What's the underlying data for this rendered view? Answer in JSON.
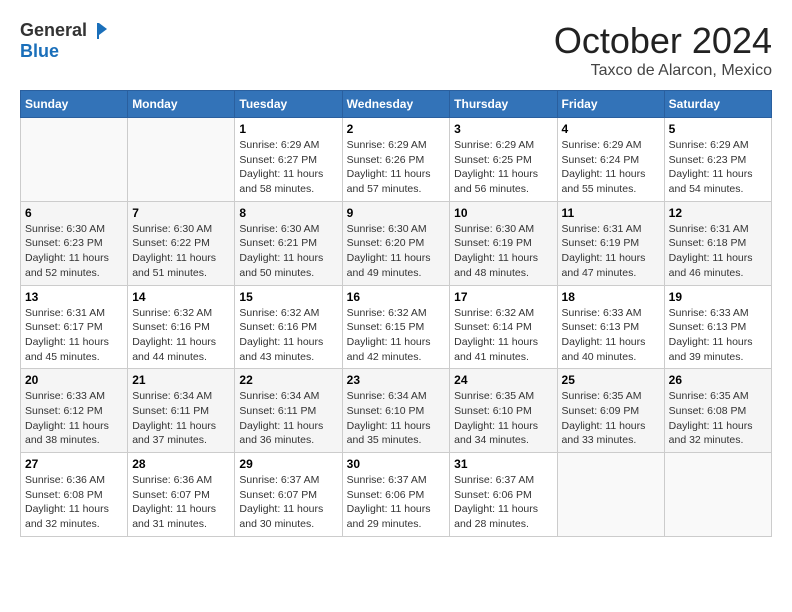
{
  "header": {
    "logo_line1": "General",
    "logo_line2": "Blue",
    "month": "October 2024",
    "location": "Taxco de Alarcon, Mexico"
  },
  "days_of_week": [
    "Sunday",
    "Monday",
    "Tuesday",
    "Wednesday",
    "Thursday",
    "Friday",
    "Saturday"
  ],
  "weeks": [
    [
      {
        "day": "",
        "content": ""
      },
      {
        "day": "",
        "content": ""
      },
      {
        "day": "1",
        "content": "Sunrise: 6:29 AM\nSunset: 6:27 PM\nDaylight: 11 hours\nand 58 minutes."
      },
      {
        "day": "2",
        "content": "Sunrise: 6:29 AM\nSunset: 6:26 PM\nDaylight: 11 hours\nand 57 minutes."
      },
      {
        "day": "3",
        "content": "Sunrise: 6:29 AM\nSunset: 6:25 PM\nDaylight: 11 hours\nand 56 minutes."
      },
      {
        "day": "4",
        "content": "Sunrise: 6:29 AM\nSunset: 6:24 PM\nDaylight: 11 hours\nand 55 minutes."
      },
      {
        "day": "5",
        "content": "Sunrise: 6:29 AM\nSunset: 6:23 PM\nDaylight: 11 hours\nand 54 minutes."
      }
    ],
    [
      {
        "day": "6",
        "content": "Sunrise: 6:30 AM\nSunset: 6:23 PM\nDaylight: 11 hours\nand 52 minutes."
      },
      {
        "day": "7",
        "content": "Sunrise: 6:30 AM\nSunset: 6:22 PM\nDaylight: 11 hours\nand 51 minutes."
      },
      {
        "day": "8",
        "content": "Sunrise: 6:30 AM\nSunset: 6:21 PM\nDaylight: 11 hours\nand 50 minutes."
      },
      {
        "day": "9",
        "content": "Sunrise: 6:30 AM\nSunset: 6:20 PM\nDaylight: 11 hours\nand 49 minutes."
      },
      {
        "day": "10",
        "content": "Sunrise: 6:30 AM\nSunset: 6:19 PM\nDaylight: 11 hours\nand 48 minutes."
      },
      {
        "day": "11",
        "content": "Sunrise: 6:31 AM\nSunset: 6:19 PM\nDaylight: 11 hours\nand 47 minutes."
      },
      {
        "day": "12",
        "content": "Sunrise: 6:31 AM\nSunset: 6:18 PM\nDaylight: 11 hours\nand 46 minutes."
      }
    ],
    [
      {
        "day": "13",
        "content": "Sunrise: 6:31 AM\nSunset: 6:17 PM\nDaylight: 11 hours\nand 45 minutes."
      },
      {
        "day": "14",
        "content": "Sunrise: 6:32 AM\nSunset: 6:16 PM\nDaylight: 11 hours\nand 44 minutes."
      },
      {
        "day": "15",
        "content": "Sunrise: 6:32 AM\nSunset: 6:16 PM\nDaylight: 11 hours\nand 43 minutes."
      },
      {
        "day": "16",
        "content": "Sunrise: 6:32 AM\nSunset: 6:15 PM\nDaylight: 11 hours\nand 42 minutes."
      },
      {
        "day": "17",
        "content": "Sunrise: 6:32 AM\nSunset: 6:14 PM\nDaylight: 11 hours\nand 41 minutes."
      },
      {
        "day": "18",
        "content": "Sunrise: 6:33 AM\nSunset: 6:13 PM\nDaylight: 11 hours\nand 40 minutes."
      },
      {
        "day": "19",
        "content": "Sunrise: 6:33 AM\nSunset: 6:13 PM\nDaylight: 11 hours\nand 39 minutes."
      }
    ],
    [
      {
        "day": "20",
        "content": "Sunrise: 6:33 AM\nSunset: 6:12 PM\nDaylight: 11 hours\nand 38 minutes."
      },
      {
        "day": "21",
        "content": "Sunrise: 6:34 AM\nSunset: 6:11 PM\nDaylight: 11 hours\nand 37 minutes."
      },
      {
        "day": "22",
        "content": "Sunrise: 6:34 AM\nSunset: 6:11 PM\nDaylight: 11 hours\nand 36 minutes."
      },
      {
        "day": "23",
        "content": "Sunrise: 6:34 AM\nSunset: 6:10 PM\nDaylight: 11 hours\nand 35 minutes."
      },
      {
        "day": "24",
        "content": "Sunrise: 6:35 AM\nSunset: 6:10 PM\nDaylight: 11 hours\nand 34 minutes."
      },
      {
        "day": "25",
        "content": "Sunrise: 6:35 AM\nSunset: 6:09 PM\nDaylight: 11 hours\nand 33 minutes."
      },
      {
        "day": "26",
        "content": "Sunrise: 6:35 AM\nSunset: 6:08 PM\nDaylight: 11 hours\nand 32 minutes."
      }
    ],
    [
      {
        "day": "27",
        "content": "Sunrise: 6:36 AM\nSunset: 6:08 PM\nDaylight: 11 hours\nand 32 minutes."
      },
      {
        "day": "28",
        "content": "Sunrise: 6:36 AM\nSunset: 6:07 PM\nDaylight: 11 hours\nand 31 minutes."
      },
      {
        "day": "29",
        "content": "Sunrise: 6:37 AM\nSunset: 6:07 PM\nDaylight: 11 hours\nand 30 minutes."
      },
      {
        "day": "30",
        "content": "Sunrise: 6:37 AM\nSunset: 6:06 PM\nDaylight: 11 hours\nand 29 minutes."
      },
      {
        "day": "31",
        "content": "Sunrise: 6:37 AM\nSunset: 6:06 PM\nDaylight: 11 hours\nand 28 minutes."
      },
      {
        "day": "",
        "content": ""
      },
      {
        "day": "",
        "content": ""
      }
    ]
  ]
}
